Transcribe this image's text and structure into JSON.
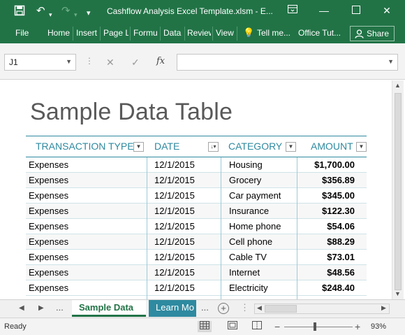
{
  "window": {
    "title": "Cashflow Analysis Excel Template.xlsm - E...",
    "quick_access": {
      "save_icon": "save-icon",
      "undo_glyph": "↶",
      "redo_glyph": "↷",
      "customize_glyph": "▾"
    },
    "controls": {
      "minimize": "—",
      "restore": "▭",
      "maximize": "☐",
      "close": "✕"
    }
  },
  "ribbon": {
    "file": "File",
    "tabs": [
      "Home",
      "Insert",
      "Page L",
      "Formu",
      "Data",
      "Review",
      "View"
    ],
    "tell_me": "Tell me...",
    "office_tut": "Office Tut...",
    "share": "Share"
  },
  "formula_bar": {
    "name_box": "J1",
    "cancel_glyph": "✕",
    "enter_glyph": "✓",
    "fx": "fx",
    "formula": ""
  },
  "sheet": {
    "title": "Sample Data Table",
    "columns": [
      "TRANSACTION TYPE",
      "DATE",
      "CATEGORY",
      "AMOUNT"
    ],
    "rows": [
      [
        "Expenses",
        "12/1/2015",
        "Housing",
        "$1,700.00"
      ],
      [
        "Expenses",
        "12/1/2015",
        "Grocery",
        "$356.89"
      ],
      [
        "Expenses",
        "12/1/2015",
        "Car payment",
        "$345.00"
      ],
      [
        "Expenses",
        "12/1/2015",
        "Insurance",
        "$122.30"
      ],
      [
        "Expenses",
        "12/1/2015",
        "Home phone",
        "$54.06"
      ],
      [
        "Expenses",
        "12/1/2015",
        "Cell phone",
        "$88.29"
      ],
      [
        "Expenses",
        "12/1/2015",
        "Cable TV",
        "$73.01"
      ],
      [
        "Expenses",
        "12/1/2015",
        "Internet",
        "$48.56"
      ],
      [
        "Expenses",
        "12/1/2015",
        "Electricity",
        "$248.40"
      ]
    ]
  },
  "sheet_tabs": {
    "prev": "◀",
    "next": "▶",
    "more_left": "...",
    "tabs": [
      "Sample Data",
      "Learn Mo"
    ],
    "more_right": "...",
    "add": "+"
  },
  "status_bar": {
    "ready": "Ready",
    "zoom": "93%",
    "zoom_minus": "−",
    "zoom_plus": "+"
  },
  "colors": {
    "excel_green": "#217346",
    "table_accent": "#2e8aa0"
  }
}
